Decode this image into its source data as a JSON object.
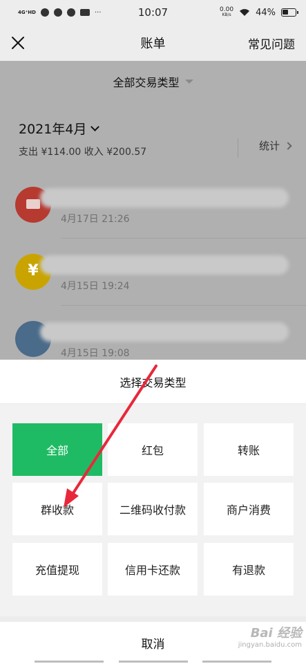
{
  "status_bar": {
    "network": "4G⁺HD",
    "time": "10:07",
    "speed_value": "0.00",
    "speed_unit": "KB/s",
    "battery": "44%"
  },
  "nav": {
    "title": "账单",
    "faq": "常见问题"
  },
  "background": {
    "filter_label": "全部交易类型",
    "month": "2021年4月",
    "summary": "支出 ¥114.00 收入 ¥200.57",
    "stats_label": "统计",
    "transactions": [
      {
        "time": "4月17日 21:26",
        "icon": "red-envelope-icon"
      },
      {
        "time": "4月15日 19:24",
        "icon": "coin-icon"
      },
      {
        "time": "4月15日 19:08",
        "icon": "avatar-photo-icon"
      }
    ]
  },
  "sheet": {
    "title": "选择交易类型",
    "options": [
      "全部",
      "红包",
      "转账",
      "群收款",
      "二维码收付款",
      "商户消费",
      "充值提现",
      "信用卡还款",
      "有退款"
    ],
    "selected_index": 0,
    "cancel": "取消"
  },
  "watermark": {
    "main": "Bai 经验",
    "sub": "jingyan.baidu.com"
  },
  "colors": {
    "accent_green": "#1fbb64",
    "annotation_red": "#e8283a"
  }
}
